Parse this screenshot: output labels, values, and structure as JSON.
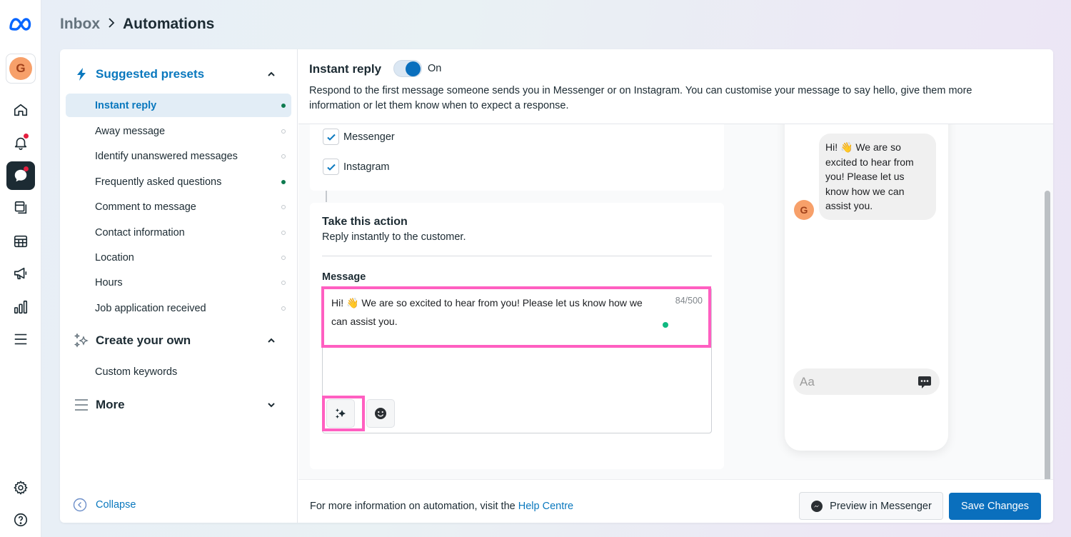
{
  "breadcrumb": {
    "parent": "Inbox",
    "separator": ">",
    "current": "Automations"
  },
  "user": {
    "initial": "G",
    "avatar_color": "#f7a06a"
  },
  "rail": {
    "items": [
      {
        "icon": "home-icon"
      },
      {
        "icon": "bell-icon",
        "badge": true
      },
      {
        "icon": "inbox-chat-icon",
        "active": true,
        "badge": true
      },
      {
        "icon": "posts-icon"
      },
      {
        "icon": "planner-icon"
      },
      {
        "icon": "ads-megaphone-icon"
      },
      {
        "icon": "insights-icon"
      },
      {
        "icon": "menu-icon"
      }
    ],
    "bottom": [
      {
        "icon": "settings-icon"
      },
      {
        "icon": "help-icon"
      }
    ]
  },
  "nav": {
    "suggested": {
      "title": "Suggested presets",
      "items": [
        {
          "label": "Instant reply",
          "active": true,
          "status": "on"
        },
        {
          "label": "Away message",
          "status": "off"
        },
        {
          "label": "Identify unanswered messages",
          "status": "off"
        },
        {
          "label": "Frequently asked questions",
          "status": "on"
        },
        {
          "label": "Comment to message",
          "status": "off"
        },
        {
          "label": "Contact information",
          "status": "off"
        },
        {
          "label": "Location",
          "status": "off"
        },
        {
          "label": "Hours",
          "status": "off"
        },
        {
          "label": "Job application received",
          "status": "off"
        }
      ]
    },
    "create": {
      "title": "Create your own",
      "items": [
        {
          "label": "Custom keywords"
        }
      ]
    },
    "more": {
      "title": "More"
    },
    "collapse_label": "Collapse"
  },
  "header": {
    "title": "Instant reply",
    "toggle_state": "On",
    "toggle_on": true,
    "description": "Respond to the first message someone sends you in Messenger or on Instagram. You can customise your message to say hello, give them more information or let them know when to expect a response."
  },
  "platforms": [
    {
      "label": "Messenger",
      "checked": true
    },
    {
      "label": "Instagram",
      "checked": true
    }
  ],
  "action": {
    "title": "Take this action",
    "subtitle": "Reply instantly to the customer.",
    "message_label": "Message",
    "message_text": "Hi! 👋 We are so excited to hear from you! Please let us know how we can assist you.",
    "char_count": "84/500"
  },
  "preview": {
    "bubble_text": "Hi! 👋 We are so excited to hear from you! Please let us know how we can assist you.",
    "avatar_initial": "G",
    "input_placeholder": "Aa"
  },
  "footer": {
    "info_text": "For more information on automation, visit the ",
    "help_link": "Help Centre",
    "preview_button": "Preview in Messenger",
    "save_button": "Save Changes"
  },
  "colors": {
    "accent": "#0a78be",
    "primary_button": "#0a6fbd",
    "active_status": "#0e7a4f",
    "highlight": "#ff5fc1"
  }
}
